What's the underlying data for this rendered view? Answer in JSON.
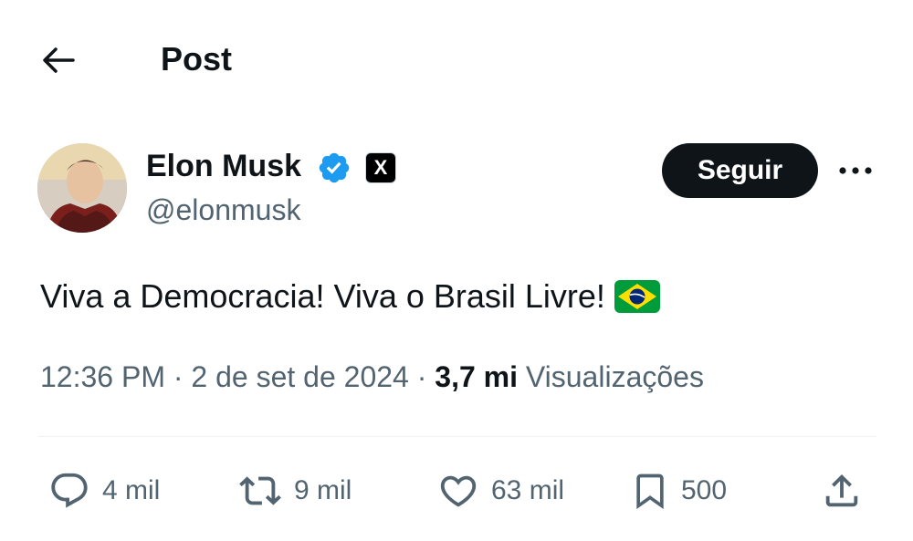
{
  "header": {
    "back_icon": "arrow-left-icon",
    "title": "Post"
  },
  "author": {
    "name": "Elon Musk",
    "handle": "@elonmusk",
    "verified_icon": "verified-badge-icon",
    "verified_color": "#1d9bf0",
    "affiliation_badge": "X"
  },
  "follow_label": "Seguir",
  "more_icon": "more-horizontal-icon",
  "post": {
    "text": "Viva a Democracia! Viva o Brasil Livre!",
    "emoji": "brazil-flag-icon"
  },
  "meta": {
    "time": "12:36 PM",
    "sep1": "·",
    "date": "2 de set de 2024",
    "sep2": "·",
    "views_count": "3,7 mi",
    "views_label": "Visualizações"
  },
  "actions": {
    "replies": "4 mil",
    "reposts": "9 mil",
    "likes": "63 mil",
    "bookmarks": "500"
  },
  "colors": {
    "text": "#0f1419",
    "secondary": "#536471",
    "accent": "#1d9bf0",
    "divider": "#eff3f4"
  }
}
